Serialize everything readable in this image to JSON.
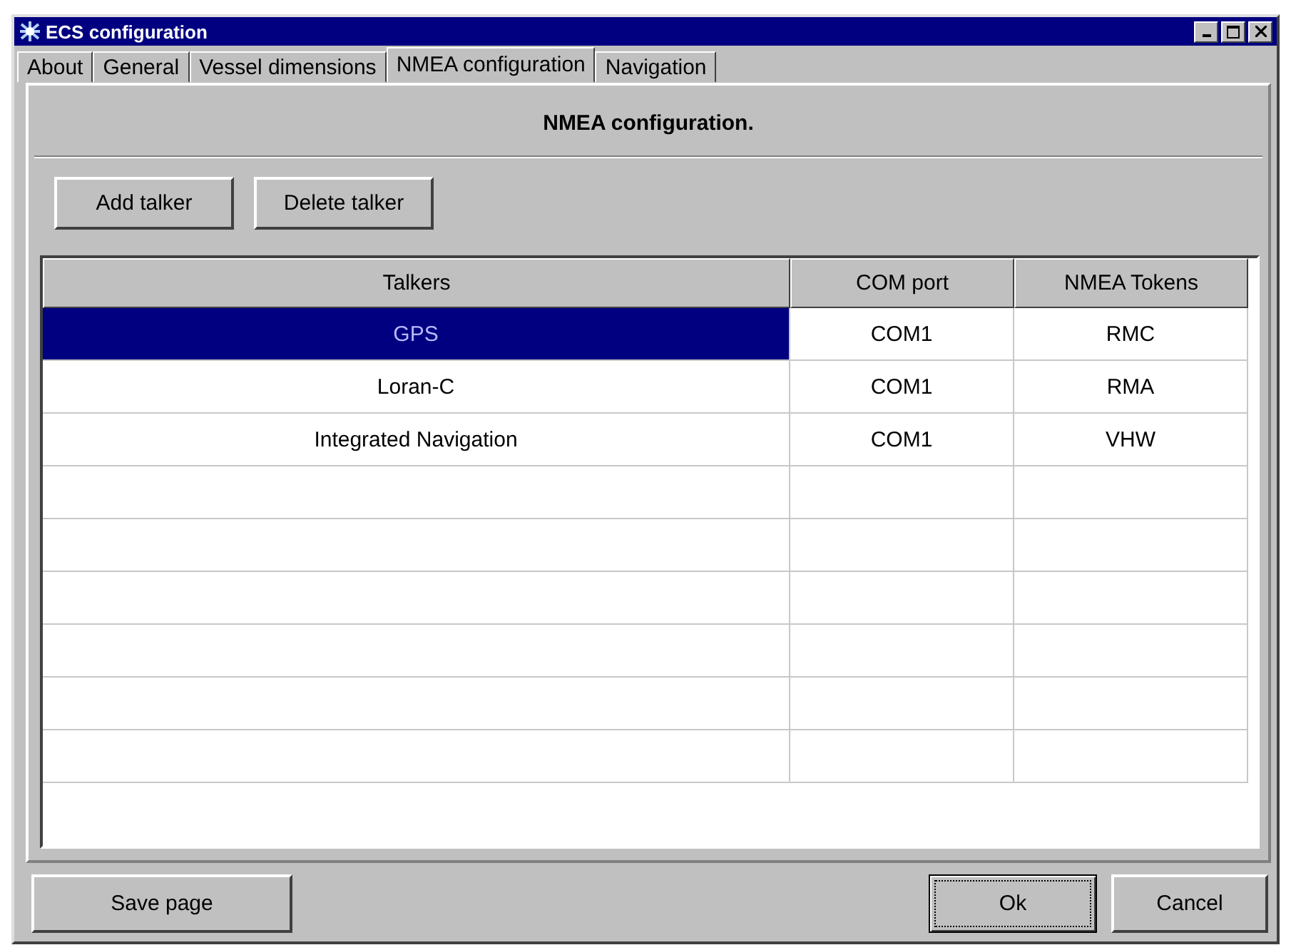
{
  "window": {
    "title": "ECS configuration"
  },
  "tabs": [
    {
      "label": "About",
      "selected": false
    },
    {
      "label": "General",
      "selected": false
    },
    {
      "label": "Vessel dimensions",
      "selected": false
    },
    {
      "label": "NMEA configuration",
      "selected": true
    },
    {
      "label": "Navigation",
      "selected": false
    }
  ],
  "heading": "NMEA configuration.",
  "toolbar_buttons": [
    "Add talker",
    "Delete talker"
  ],
  "table": {
    "columns": [
      "Talkers",
      "COM port",
      "NMEA Tokens"
    ],
    "rows": [
      {
        "cells": [
          "GPS",
          "COM1",
          "RMC"
        ],
        "selected": true
      },
      {
        "cells": [
          "Loran-C",
          "COM1",
          "RMA"
        ],
        "selected": false
      },
      {
        "cells": [
          "Integrated Navigation",
          "COM1",
          "VHW"
        ],
        "selected": false
      }
    ]
  },
  "footer_buttons": [
    {
      "label": "Save page",
      "default": false
    },
    {
      "label": "Ok",
      "default": true
    },
    {
      "label": "Cancel",
      "default": false
    }
  ]
}
